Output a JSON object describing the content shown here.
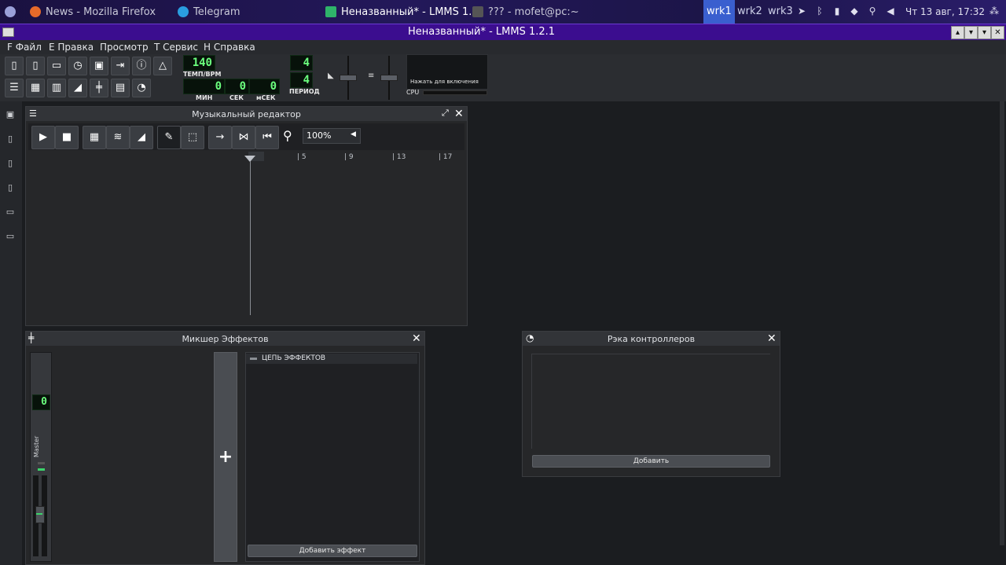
{
  "taskbar": {
    "tasks": [
      {
        "label": "News - Mozilla Firefox"
      },
      {
        "label": "Telegram"
      },
      {
        "label": "Неназванный* - LMMS 1..."
      },
      {
        "label": "??? - mofet@pc:~"
      }
    ],
    "workspaces": [
      "wrk1",
      "wrk2",
      "wrk3"
    ],
    "clock": "Чт 13 авг, 17:32"
  },
  "app": {
    "title": "Неназванный* - LMMS 1.2.1",
    "menu": [
      "F Файл",
      "E Правка",
      "Просмотр",
      "T Сервис",
      "H Справка"
    ]
  },
  "toolbar": {
    "tempo": "140",
    "tempo_label": "ТЕМП/BPM",
    "min_value": "0",
    "sec_value": "0",
    "msec_value": "0",
    "min_label": "МИН",
    "sec_label": "СЕК",
    "msec_label": "мСЕК",
    "ts_num": "4",
    "ts_den": "4",
    "period_label": "ПЕРИОД",
    "cpu_hint": "Нажать для включения",
    "cpu_label": "CPU"
  },
  "song_editor": {
    "title": "Музыкальный редактор",
    "zoom": "100%",
    "ruler": [
      "5",
      "9",
      "13",
      "17"
    ]
  },
  "mixer": {
    "title": "Микшер Эффектов",
    "channel_value": "0",
    "channel_name": "Master",
    "fx_chain": "ЦЕПЬ ЭФФЕКТОВ",
    "add_effect": "Добавить эффект",
    "add_channel": "+"
  },
  "controller_rack": {
    "title": "Рэка контроллеров",
    "add": "Добавить"
  },
  "colors": {
    "accent": "#3b0d8f",
    "lcd": "#6bff7e",
    "workspace_selected": "#3a5fcf"
  }
}
